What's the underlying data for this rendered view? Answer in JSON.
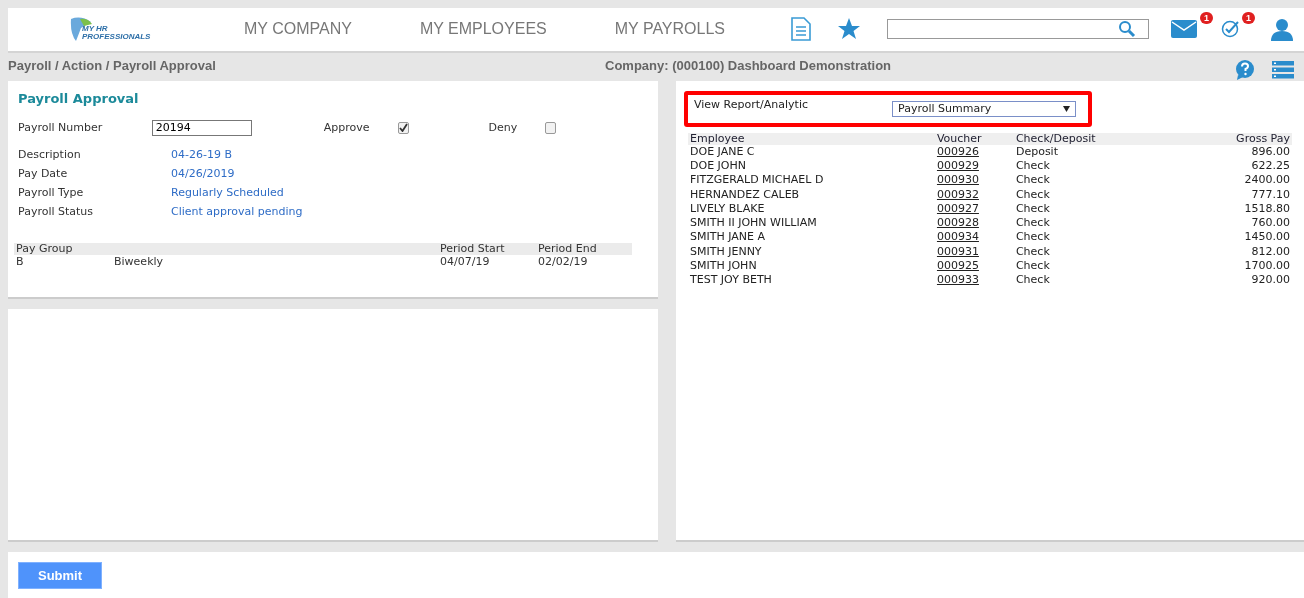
{
  "logo": {
    "line_1": "MY HR",
    "line_2": "PROFESSIONALS"
  },
  "nav": [
    {
      "label": "MY COMPANY"
    },
    {
      "label": "MY EMPLOYEES"
    },
    {
      "label": "MY PAYROLLS"
    }
  ],
  "header": {
    "mail_badge": "1",
    "tasks_badge": "1"
  },
  "breadcrumb": "Payroll / Action / Payroll Approval",
  "company": "Company: (000100) Dashboard Demonstration",
  "approval": {
    "title": "Payroll Approval",
    "number_label": "Payroll Number",
    "number_value": "20194",
    "options": [
      {
        "label": "Approve",
        "checked": true
      },
      {
        "label": "Deny",
        "checked": false
      }
    ],
    "fields": [
      {
        "label": "Description",
        "value": "04-26-19 B"
      },
      {
        "label": "Pay Date",
        "value": "04/26/2019"
      },
      {
        "label": "Payroll Type",
        "value": "Regularly Scheduled"
      },
      {
        "label": "Payroll Status",
        "value": "Client approval pending"
      }
    ],
    "pay_groups": {
      "columns": [
        "Pay Group",
        "",
        "Period Start",
        "Period End"
      ],
      "rows": [
        [
          "B",
          "Biweekly",
          "04/07/19",
          "02/02/19"
        ]
      ]
    }
  },
  "report": {
    "label": "View Report/Analytic",
    "selected": "Payroll Summary",
    "columns": [
      "Employee",
      "Voucher",
      "Check/Deposit",
      "Gross Pay"
    ],
    "rows": [
      [
        "DOE JANE C",
        "000926",
        "Deposit",
        "896.00"
      ],
      [
        "DOE JOHN",
        "000929",
        "Check",
        "622.25"
      ],
      [
        "FITZGERALD MICHAEL D",
        "000930",
        "Check",
        "2400.00"
      ],
      [
        "HERNANDEZ CALEB",
        "000932",
        "Check",
        "777.10"
      ],
      [
        "LIVELY BLAKE",
        "000927",
        "Check",
        "1518.80"
      ],
      [
        "SMITH II JOHN WILLIAM",
        "000928",
        "Check",
        "760.00"
      ],
      [
        "SMITH JANE A",
        "000934",
        "Check",
        "1450.00"
      ],
      [
        "SMITH JENNY",
        "000931",
        "Check",
        "812.00"
      ],
      [
        "SMITH JOHN",
        "000925",
        "Check",
        "1700.00"
      ],
      [
        "TEST JOY BETH",
        "000933",
        "Check",
        "920.00"
      ]
    ]
  },
  "submit": "Submit"
}
